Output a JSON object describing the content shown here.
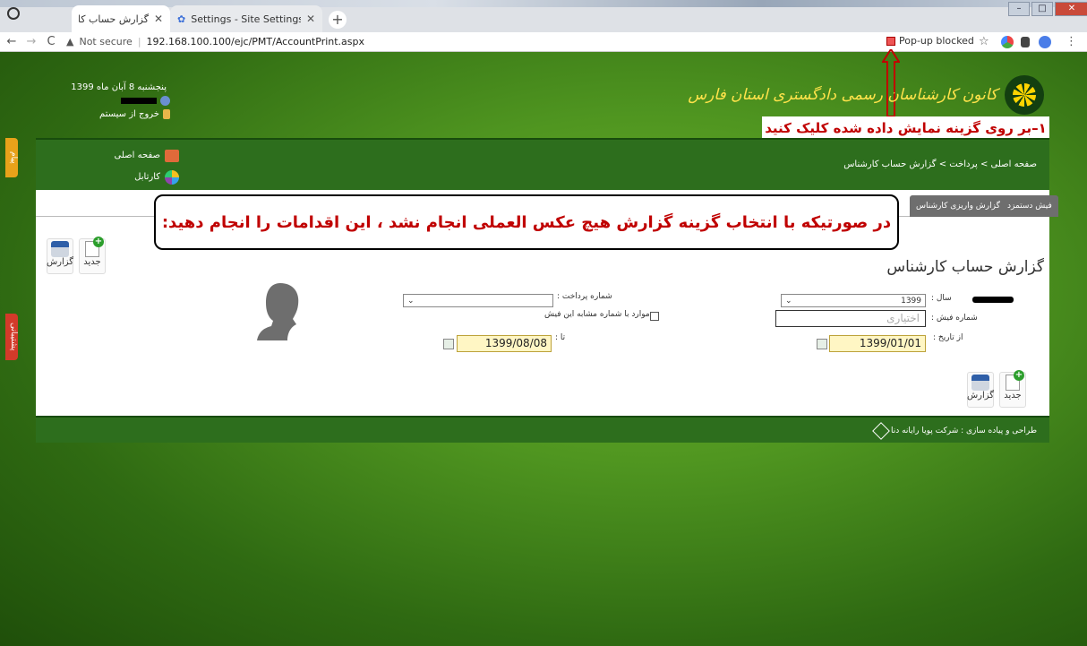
{
  "browser": {
    "tabs": [
      {
        "title": "گزارش حساب کارشناس",
        "close": "✕"
      },
      {
        "title": "Settings - Site Settings",
        "close": "✕"
      }
    ],
    "new_tab": "+",
    "window_controls": [
      "–",
      "□",
      "✕"
    ],
    "nav": {
      "back": "←",
      "forward": "→",
      "reload": "C"
    },
    "security": "Not secure",
    "url": "192.168.100.100/ejc/PMT/AccountPrint.aspx",
    "popup_blocked": "Pop-up blocked",
    "star": "☆",
    "menu": "⋮"
  },
  "header": {
    "date": "پنجشنبه 8 آبان ماه 1399",
    "logout": "خروج از سیستم",
    "logo_text": "کانون کارشناسان رسمی دادگستری استان فارس",
    "instruction_1": "۱–بر روی گزینه نمایش داده شده کلیک کنید"
  },
  "nav_band": {
    "home": "صفحه اصلی",
    "cartable": "کارتابل",
    "breadcrumb": "صفحه اصلی > پرداخت > گزارش حساب کارشناس"
  },
  "side_tags": {
    "message": "پیام",
    "support": "پشتیبانی"
  },
  "tabs": [
    {
      "label": "گزارش واریزی کارشناس"
    },
    {
      "label": "فیش دستمزد"
    }
  ],
  "instruction_2": "در صورتیکه با انتخاب گزینه گزارش هیچ عکس العملی انجام نشد ، این اقدامات را انجام  دهید:",
  "toolbar": {
    "new": "جدید",
    "report": "گزارش"
  },
  "page_title": "گزارش حساب کارشناس",
  "form": {
    "year_label": "سال :",
    "year_value": "1399",
    "receipt_label": "شماره فیش :",
    "receipt_placeholder": "اختیاری",
    "from_date_label": "از تاریخ :",
    "from_date": "1399/01/01",
    "payment_no_label": "شماره پرداخت :",
    "payment_no_value": "",
    "similar_label": "موارد با شماره مشابه این فیش",
    "to_date_label": "تا :",
    "to_date": "1399/08/08"
  },
  "footer": "طراحی و پیاده سازی : شرکت پویا رایانه دنا",
  "colors": {
    "accent_red": "#c00000",
    "band_green": "#2d6e1d",
    "logo_yellow": "#ffe34a"
  }
}
